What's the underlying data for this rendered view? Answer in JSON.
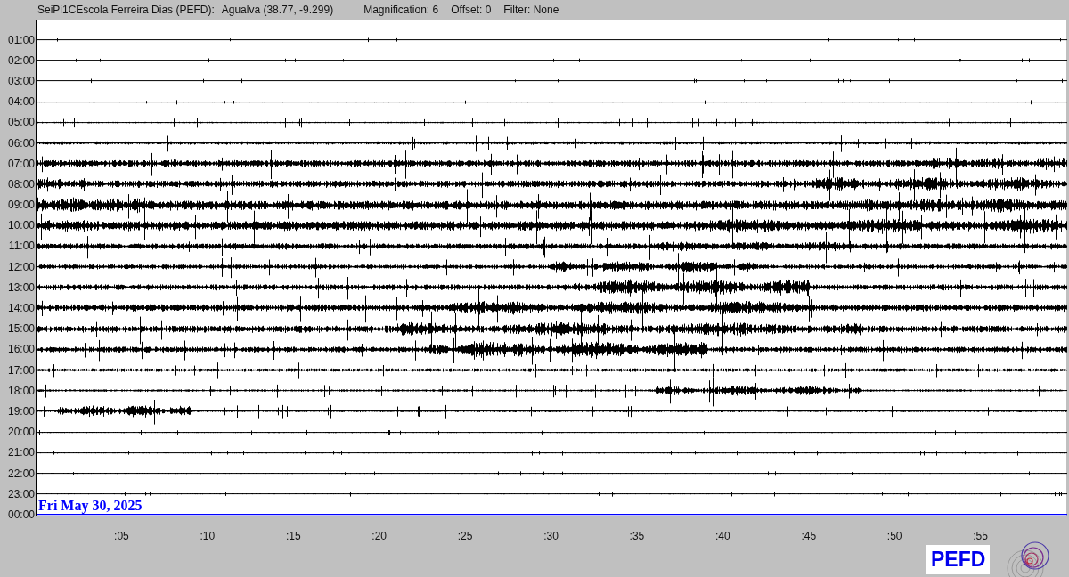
{
  "header": {
    "station": "SeiPi1CEscola Ferreira Dias (PEFD):",
    "location": "Agualva (38.77, -9.299)",
    "magnification": "Magnification: 6",
    "offset": "Offset: 0",
    "filter": "Filter: None"
  },
  "rows": [
    {
      "time": "01:00",
      "kind": "trace"
    },
    {
      "time": "02:00",
      "kind": "trace"
    },
    {
      "time": "03:00",
      "kind": "trace"
    },
    {
      "time": "04:00",
      "kind": "trace"
    },
    {
      "time": "05:00",
      "kind": "trace"
    },
    {
      "time": "06:00",
      "kind": "trace"
    },
    {
      "time": "07:00",
      "kind": "trace"
    },
    {
      "time": "08:00",
      "kind": "trace"
    },
    {
      "time": "09:00",
      "kind": "trace"
    },
    {
      "time": "10:00",
      "kind": "trace"
    },
    {
      "time": "11:00",
      "kind": "trace"
    },
    {
      "time": "12:00",
      "kind": "trace"
    },
    {
      "time": "13:00",
      "kind": "trace"
    },
    {
      "time": "14:00",
      "kind": "trace"
    },
    {
      "time": "15:00",
      "kind": "trace"
    },
    {
      "time": "16:00",
      "kind": "trace"
    },
    {
      "time": "17:00",
      "kind": "trace"
    },
    {
      "time": "18:00",
      "kind": "trace"
    },
    {
      "time": "19:00",
      "kind": "trace"
    },
    {
      "time": "20:00",
      "kind": "trace"
    },
    {
      "time": "21:00",
      "kind": "trace"
    },
    {
      "time": "22:00",
      "kind": "trace"
    },
    {
      "time": "23:00",
      "kind": "trace"
    },
    {
      "time": "00:00",
      "kind": "current"
    }
  ],
  "date_label": "Fri May 30, 2025",
  "minute_ticks": [
    ":05",
    ":10",
    ":15",
    ":20",
    ":25",
    ":30",
    ":35",
    ":40",
    ":45",
    ":50",
    ":55"
  ],
  "station_badge": "PEFD"
}
